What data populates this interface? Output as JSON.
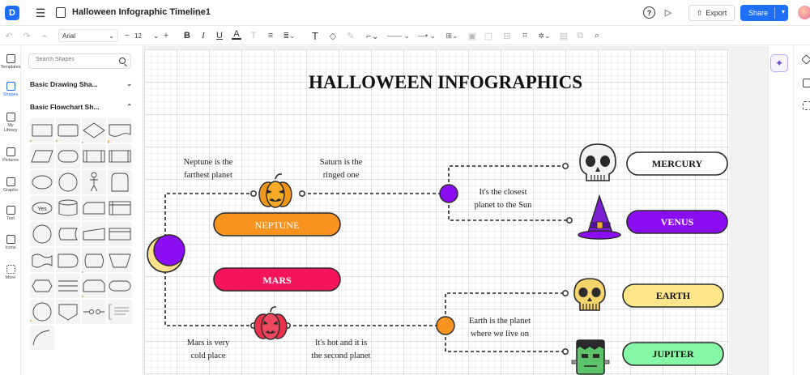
{
  "app": {
    "logo_letter": "D",
    "doc_title": "Halloween Infographic Timeline1",
    "export_label": "Export",
    "share_label": "Share"
  },
  "toolbar": {
    "font_family": "Arial",
    "font_size": "12"
  },
  "rail": {
    "items": [
      {
        "label": "Templates",
        "icon": "templates-icon"
      },
      {
        "label": "Shapes",
        "icon": "shapes-icon"
      },
      {
        "label": "My Library",
        "icon": "library-icon"
      },
      {
        "label": "Pictures",
        "icon": "pictures-icon"
      },
      {
        "label": "Graphs",
        "icon": "graphs-icon"
      },
      {
        "label": "Text",
        "icon": "text-icon"
      },
      {
        "label": "Icons",
        "icon": "icons-icon"
      },
      {
        "label": "More",
        "icon": "more-icon"
      }
    ]
  },
  "panel": {
    "search_placeholder": "Search Shapes",
    "sections": [
      {
        "title": "Basic Drawing Sha...",
        "expanded": false
      },
      {
        "title": "Basic Flowchart Sh...",
        "expanded": true
      }
    ],
    "yes_shape_label": "Yes"
  },
  "diagram": {
    "title": "HALLOWEEN INFOGRAPHICS",
    "planets": [
      {
        "name": "NEPTUNE",
        "color": "#f7931e"
      },
      {
        "name": "MARS",
        "color": "#f5135c"
      },
      {
        "name": "MERCURY",
        "color": "#ffffff"
      },
      {
        "name": "VENUS",
        "color": "#8b0ef2"
      },
      {
        "name": "EARTH",
        "color": "#fde68a"
      },
      {
        "name": "JUPITER",
        "color": "#86f7a4"
      }
    ],
    "notes": {
      "neptune_1": "Neptune is the",
      "neptune_2": "farthest planet",
      "saturn_1": "Saturn is the",
      "saturn_2": "ringed one",
      "closest_1": "It's the closest",
      "closest_2": "planet to the Sun",
      "earth_1": "Earth is the planet",
      "earth_2": "where we live on",
      "mars_1": "Mars is very",
      "mars_2": "cold place",
      "hot_1": "It's hot and it is",
      "hot_2": "the second planet"
    },
    "colors": {
      "purple": "#8b0ef2",
      "orange": "#f7931e",
      "pumpkin": "#f0961a",
      "red_pumpkin": "#e8334a",
      "skull": "#f3f3f3",
      "gold_skull": "#f6d36b",
      "frankenstein": "#5cc36b"
    }
  }
}
